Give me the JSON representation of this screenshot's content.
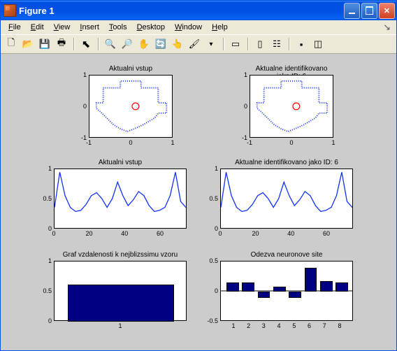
{
  "window": {
    "title": "Figure 1"
  },
  "menu": {
    "file": "File",
    "edit": "Edit",
    "view": "View",
    "insert": "Insert",
    "tools": "Tools",
    "desktop": "Desktop",
    "window": "Window",
    "help": "Help"
  },
  "toolbar": {
    "new": "new-figure-icon",
    "open": "open-file-icon",
    "save": "save-icon",
    "print": "print-icon",
    "arrow": "pointer-icon",
    "zoom_in": "zoom-in-icon",
    "zoom_out": "zoom-out-icon",
    "pan": "pan-icon",
    "rotate": "rotate-3d-icon",
    "cursor": "data-cursor-icon",
    "brush": "brush-icon",
    "link": "link-icon",
    "colorbar": "colorbar-icon",
    "legend": "legend-icon",
    "hide": "hide-tools-icon",
    "show": "show-tools-icon"
  },
  "plots": {
    "p1": {
      "title": "Aktualni vstup",
      "xticks": [
        "-1",
        "0",
        "1"
      ],
      "yticks": [
        "-1",
        "0",
        "1"
      ]
    },
    "p2": {
      "title": "Aktualne identifikovano jako ID: 6",
      "xticks": [
        "-1",
        "0",
        "1"
      ],
      "yticks": [
        "-1",
        "0",
        "1"
      ]
    },
    "p3": {
      "title": "Aktualni vstup",
      "xticks": [
        "0",
        "20",
        "40",
        "60"
      ],
      "yticks": [
        "0",
        "0.5",
        "1"
      ]
    },
    "p4": {
      "title": "Aktualne identifikovano jako ID: 6",
      "xticks": [
        "0",
        "20",
        "40",
        "60"
      ],
      "yticks": [
        "0",
        "0.5",
        "1"
      ]
    },
    "p5": {
      "title": "Graf vzdalenosti k nejblizssimu vzoru",
      "xticks": [
        "1"
      ],
      "yticks": [
        "0",
        "0.5",
        "1"
      ]
    },
    "p6": {
      "title": "Odezva neuronove site",
      "xticks": [
        "1",
        "2",
        "3",
        "4",
        "5",
        "6",
        "7",
        "8"
      ],
      "yticks": [
        "-0.5",
        "0",
        "0.5"
      ]
    }
  },
  "chart_data": [
    {
      "id": "p1",
      "type": "scatter",
      "title": "Aktualni vstup",
      "xlabel": "",
      "ylabel": "",
      "xlim": [
        -1,
        1
      ],
      "ylim": [
        -1,
        1
      ],
      "note": "closed contour of blue points forming a cross/plus shape with a small red open-circle marker near (0.1,0)",
      "marker": {
        "shape": "circle",
        "cx": 0.1,
        "cy": 0.0,
        "r": 0.1,
        "color": "#ff0000"
      }
    },
    {
      "id": "p2",
      "type": "scatter",
      "title": "Aktualne identifikovano jako ID: 6",
      "xlabel": "",
      "ylabel": "",
      "xlim": [
        -1,
        1
      ],
      "ylim": [
        -1,
        1
      ],
      "note": "closed contour of blue points forming a cross/plus shape with a small red open-circle marker near (0.1,0)",
      "marker": {
        "shape": "circle",
        "cx": 0.1,
        "cy": 0.0,
        "r": 0.1,
        "color": "#ff0000"
      }
    },
    {
      "id": "p3",
      "type": "line",
      "title": "Aktualni vstup",
      "xlabel": "",
      "ylabel": "",
      "xlim": [
        0,
        75
      ],
      "ylim": [
        0,
        1
      ],
      "x": [
        0,
        3,
        6,
        9,
        12,
        15,
        18,
        21,
        24,
        27,
        30,
        33,
        36,
        39,
        42,
        45,
        48,
        51,
        54,
        57,
        60,
        63,
        66,
        69,
        72,
        75
      ],
      "y": [
        0.35,
        0.95,
        0.55,
        0.35,
        0.28,
        0.3,
        0.4,
        0.55,
        0.6,
        0.5,
        0.35,
        0.5,
        0.78,
        0.55,
        0.38,
        0.48,
        0.62,
        0.55,
        0.38,
        0.28,
        0.3,
        0.35,
        0.55,
        0.95,
        0.45,
        0.35
      ]
    },
    {
      "id": "p4",
      "type": "line",
      "title": "Aktualne identifikovano jako ID: 6",
      "xlabel": "",
      "ylabel": "",
      "xlim": [
        0,
        75
      ],
      "ylim": [
        0,
        1
      ],
      "x": [
        0,
        3,
        6,
        9,
        12,
        15,
        18,
        21,
        24,
        27,
        30,
        33,
        36,
        39,
        42,
        45,
        48,
        51,
        54,
        57,
        60,
        63,
        66,
        69,
        72,
        75
      ],
      "y": [
        0.35,
        0.95,
        0.55,
        0.35,
        0.28,
        0.3,
        0.4,
        0.55,
        0.6,
        0.5,
        0.35,
        0.5,
        0.78,
        0.55,
        0.38,
        0.48,
        0.62,
        0.55,
        0.38,
        0.28,
        0.3,
        0.35,
        0.55,
        0.95,
        0.45,
        0.35
      ]
    },
    {
      "id": "p5",
      "type": "bar",
      "title": "Graf vzdalenosti k nejblizssimu vzoru",
      "xlabel": "",
      "ylabel": "",
      "ylim": [
        0,
        1
      ],
      "categories": [
        "1"
      ],
      "values": [
        0.62
      ]
    },
    {
      "id": "p6",
      "type": "bar",
      "title": "Odezva neuronove site",
      "xlabel": "",
      "ylabel": "",
      "ylim": [
        -0.5,
        0.5
      ],
      "categories": [
        "1",
        "2",
        "3",
        "4",
        "5",
        "6",
        "7",
        "8"
      ],
      "values": [
        0.15,
        0.15,
        -0.1,
        0.08,
        -0.1,
        0.4,
        0.18,
        0.15
      ]
    }
  ]
}
